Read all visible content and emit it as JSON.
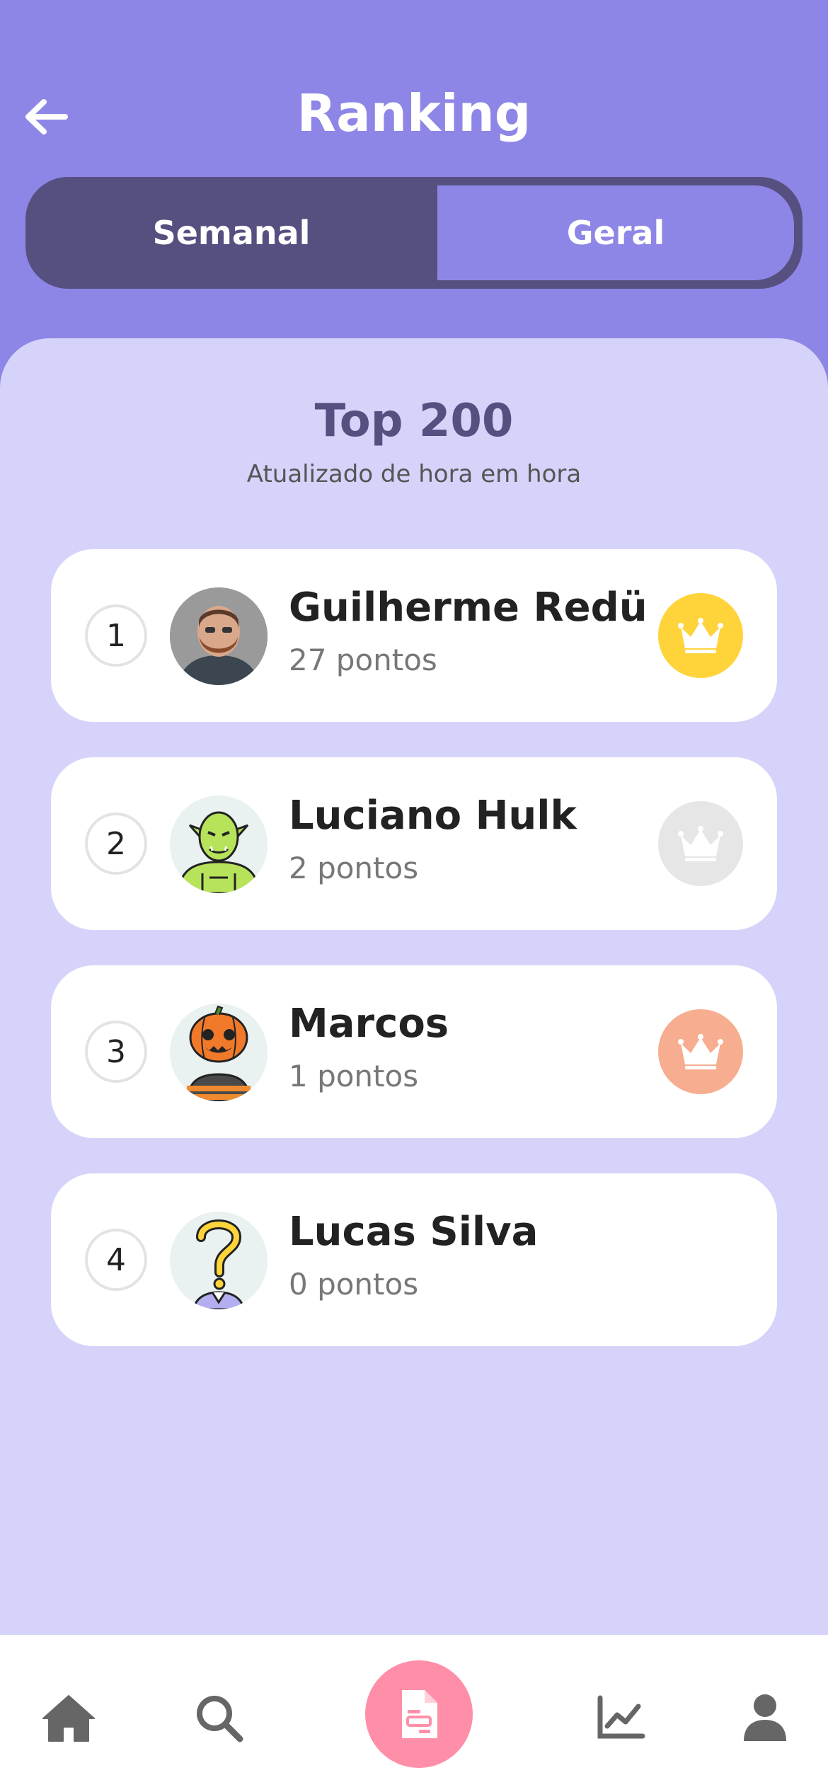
{
  "header": {
    "title": "Ranking",
    "tabs": [
      "Semanal",
      "Geral"
    ],
    "active_tab": "Semanal"
  },
  "section": {
    "title": "Top 200",
    "subtitle": "Atualizado de hora em hora"
  },
  "ranking": [
    {
      "position": "1",
      "name": "Guilherme Redü",
      "points": "27 pontos",
      "avatar": "photo-avatar",
      "crown_color": "#ffd43b"
    },
    {
      "position": "2",
      "name": "Luciano Hulk",
      "points": "2 pontos",
      "avatar": "orc-avatar",
      "crown_color": "#e6e6e6"
    },
    {
      "position": "3",
      "name": "Marcos",
      "points": "1 pontos",
      "avatar": "pumpkin-avatar",
      "crown_color": "#f7ad8f"
    },
    {
      "position": "4",
      "name": "Lucas Silva",
      "points": "0 pontos",
      "avatar": "question-avatar",
      "crown_color": null
    }
  ],
  "navbar": {
    "items": [
      "home-icon",
      "search-icon",
      "document-icon",
      "chart-icon",
      "user-icon"
    ],
    "accent": "#ff8fa8"
  },
  "colors": {
    "header_bg": "#8e86e6",
    "tab_dark": "#55507f",
    "content_bg": "#d6d3fb"
  }
}
